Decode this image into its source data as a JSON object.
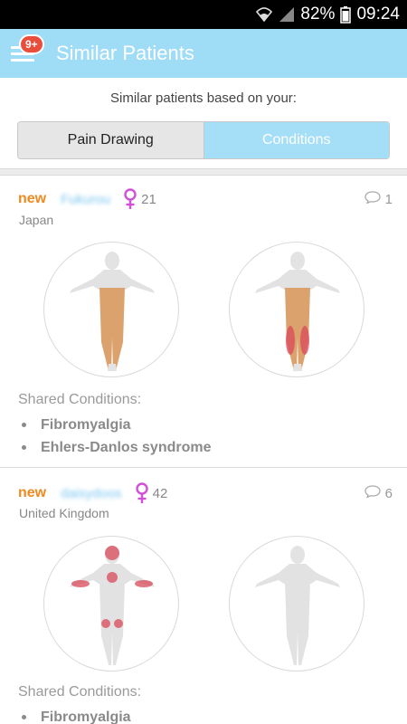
{
  "status_bar": {
    "battery": "82%",
    "time": "09:24"
  },
  "app_bar": {
    "title": "Similar Patients",
    "badge": "9+"
  },
  "subtitle": "Similar patients based on your:",
  "tabs": {
    "pain_drawing": "Pain Drawing",
    "conditions": "Conditions"
  },
  "colors": {
    "accent": "#9fdcf6",
    "new": "#f08a1e",
    "female": "#d24fd9",
    "pain": "#d9485a",
    "body": "#d8a070"
  },
  "patients": [
    {
      "new_label": "new",
      "username": "Fukurou",
      "gender_icon": "female-icon",
      "age": "21",
      "comment_count": "1",
      "country": "Japan",
      "shared_title": "Shared Conditions:",
      "conditions": [
        "Fibromyalgia",
        "Ehlers-Danlos syndrome"
      ]
    },
    {
      "new_label": "new",
      "username": "daisydoos",
      "gender_icon": "female-icon",
      "age": "42",
      "comment_count": "6",
      "country": "United Kingdom",
      "shared_title": "Shared Conditions:",
      "conditions": [
        "Fibromyalgia"
      ]
    }
  ]
}
